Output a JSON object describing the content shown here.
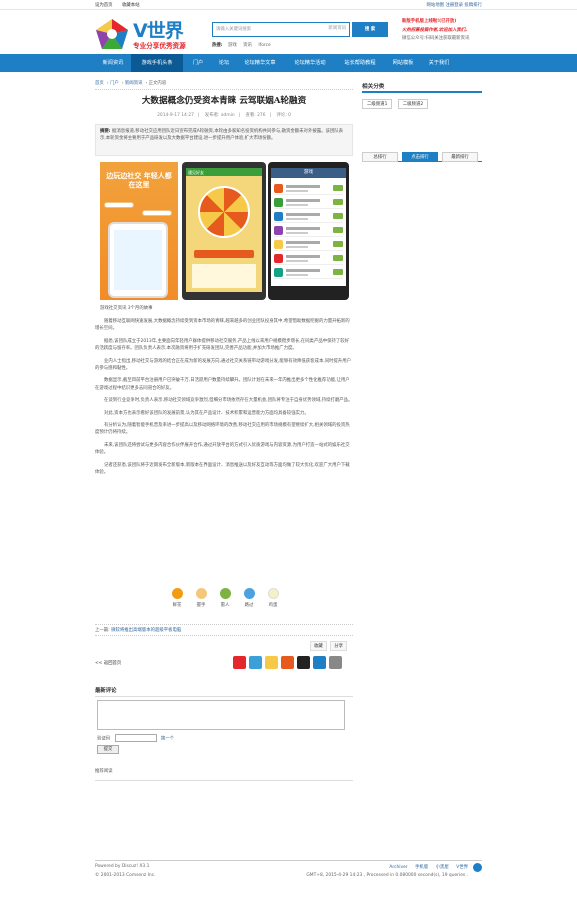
{
  "topbar": {
    "left": [
      "设为首页",
      "收藏本站"
    ],
    "right": [
      "网站地图",
      "注册登录",
      "投稿排行"
    ]
  },
  "header": {
    "logo_title": "V世界",
    "logo_tagline": "专业分享优秀资源",
    "search_placeholder": "请输入关键词搜索",
    "search_select": "新闻资讯",
    "search_button": "搜 索",
    "hot_label": "热搜:",
    "hot_words": [
      "游戏",
      "资讯",
      "Iforce"
    ],
    "right_lines": [
      "新版手机版上线啦!(已开放)",
      "火热招募投稿作者,欢迎加入我们。",
      "微信公众号:扫码关注获取最新资讯"
    ]
  },
  "nav": {
    "items": [
      "新闻资讯",
      "游戏手机头条",
      "门户",
      "论坛",
      "论坛精华文章",
      "论坛精华活动",
      "站长帮助教程",
      "网站模板",
      "关于我们"
    ],
    "active_index": 1
  },
  "breadcrumb": [
    "首页",
    "门户",
    "新闻资讯",
    "正文内容"
  ],
  "article": {
    "title": "大数据概念仍受资本青睐 云驾联姻A轮融资",
    "meta": [
      "2014-9-17 14:27",
      "发布者: admin",
      "查看: 276",
      "评论: 0"
    ],
    "summary_label": "摘要:",
    "summary": "据消息报道,移动社交应用团队近日宣布完成A轮融资,本轮由多家知名投资机构共同参与,融资金额未对外披露。该团队表示,本轮资金将主要用于产品研发以及大数据平台建设,进一步提升用户体验,扩大市场份额。",
    "pic1_title": "边玩边社交 年轻人都在这里",
    "pic2_title": "遇见好友",
    "pic3_title": "游戏",
    "caption": "游戏社交资讯 3个月的故事",
    "paragraphs": [
      "随着移动互联网快速发展,大数据概念持续受到资本市场的青睐,越来越多的创业团队投身其中,希望借助数据挖掘的力量开拓新的增长空间。",
      "据悉,该团队成立于2013年,主要面向年轻用户群体提供移动社交服务,产品上线以来用户规模稳步增长,在同类产品中保持了较好的活跃度与留存率。团队负责人表示,本次融资将用于扩充研发团队,完善产品功能,并加大市场推广力度。",
      "业内人士指出,移动社交与游戏的结合正在成为新的发展方向,通过社交关系链带动游戏分发,能够有效降低获客成本,同时提升用户的参与感和黏性。",
      "数据显示,截至目前平台注册用户已突破千万,日活跃用户数量持续攀升。团队计划在未来一年内推出更多个性化推荐功能,让用户在游戏过程中结识更多志同道合的好友。",
      "在谈到行业竞争时,负责人表示,移动社交领域竞争激烈,但细分市场依然存在大量机会,团队将专注于自身优势领域,持续打磨产品。",
      "对此,资本方也表示看好该团队的发展前景,认为其在产品设计、技术积累和运营能力方面均具备较强实力。",
      "有分析认为,随着智能手机普及率进一步提高以及移动网络环境的改善,移动社交应用的市场规模有望继续扩大,相关领域的投资热度预计仍将持续。",
      "未来,该团队还将尝试与更多内容合作伙伴展开合作,通过开放平台的方式引入优质游戏与内容资源,为用户打造一站式的娱乐社交体验。",
      "记者还获悉,该团队将于近期发布全新版本,新版本在界面设计、消息推送以及好友互动等方面均做了较大优化,欢迎广大用户下载体验。"
    ],
    "moods": [
      "鲜花",
      "握手",
      "雷人",
      "路过",
      "鸡蛋"
    ],
    "prev_label": "上一篇:",
    "prev_title": "微软将推出高端版本的超级平板电脑",
    "tools": [
      "收藏",
      "分享"
    ],
    "back": "<< 返回首页"
  },
  "comments": {
    "title": "最新评论",
    "vcode_label": "验证码",
    "vcode_link": "换一个",
    "post_button": "提交",
    "latest": "推荐阅读"
  },
  "sidebar": {
    "heading": "相关分类",
    "cats": [
      "二级频道1",
      "二级频道2"
    ],
    "tabs": [
      "总排行",
      "点击排行",
      "最新排行"
    ],
    "active_tab": 1
  },
  "footer": {
    "powered": "Powered by Discuz! X3.1",
    "copyright": "© 2001-2013 Comsenz Inc.",
    "links": [
      "Archiver",
      "手机版",
      "小黑屋",
      "V世界"
    ],
    "status": "GMT+8, 2015-4-29 14:23 , Processed in 0.080000 second(s), 19 queries ."
  },
  "colors": {
    "brand": "#1e7fc4",
    "accent": "#e3272d"
  }
}
